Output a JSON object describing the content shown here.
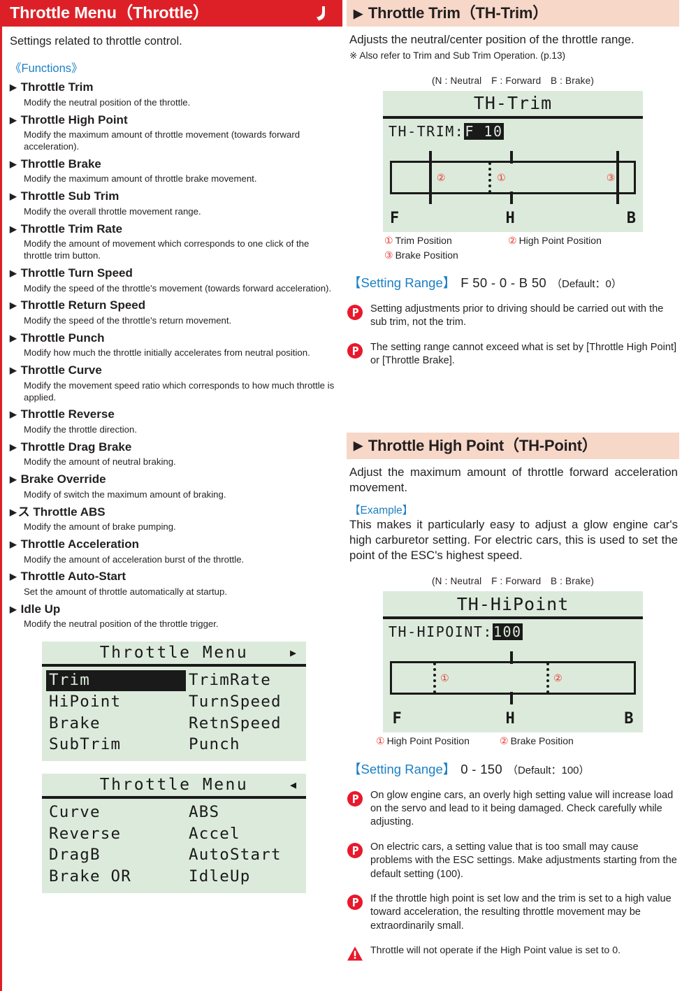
{
  "left": {
    "header_title": "Throttle Menu（Throttle）",
    "header_icon": "throttle-trigger-icon",
    "intro": "Settings related to throttle control.",
    "functions_label": "《Functions》",
    "functions": [
      {
        "name": "Throttle Trim",
        "desc": "Modify the neutral position of the throttle."
      },
      {
        "name": "Throttle High Point",
        "desc": "Modify the maximum amount of throttle movement (towards forward acceleration)."
      },
      {
        "name": "Throttle Brake",
        "desc": "Modify the maximum amount of throttle brake movement."
      },
      {
        "name": "Throttle Sub Trim",
        "desc": "Modify the overall throttle movement range."
      },
      {
        "name": "Throttle Trim Rate",
        "desc": "Modify the amount of movement which corresponds to one click of the throttle trim button."
      },
      {
        "name": "Throttle Turn Speed",
        "desc": "Modify the speed of the throttle's movement (towards forward acceleration)."
      },
      {
        "name": "Throttle Return Speed",
        "desc": "Modify the speed of the throttle's return movement."
      },
      {
        "name": "Throttle Punch",
        "desc": "Modify how much the throttle initially accelerates from neutral position."
      },
      {
        "name": "Throttle Curve",
        "desc": "Modify the movement speed ratio which corresponds to how much throttle is applied."
      },
      {
        "name": "Throttle Reverse",
        "desc": "Modify the throttle direction."
      },
      {
        "name": "Throttle Drag Brake",
        "desc": "Modify the amount of neutral braking."
      },
      {
        "name": "Brake Override",
        "desc": "Modify of switch the maximum amount of braking."
      },
      {
        "name": "ス Throttle ABS",
        "desc": "Modify the amount of brake pumping."
      },
      {
        "name": "Throttle Acceleration",
        "desc": "Modify the amount of acceleration burst of the throttle."
      },
      {
        "name": "Throttle Auto-Start",
        "desc": "Set the amount of throttle automatically at startup."
      },
      {
        "name": "Idle Up",
        "desc": "Modify the neutral position of the throttle trigger."
      }
    ],
    "lcd_menus": [
      {
        "title": "Throttle Menu",
        "arrow": "▶",
        "arrow_name": "lcd-next-page-arrow-icon",
        "items_left": [
          "Trim",
          "HiPoint",
          "Brake",
          "SubTrim"
        ],
        "items_right": [
          "TrimRate",
          "TurnSpeed",
          "RetnSpeed",
          "Punch"
        ],
        "selected": "Trim"
      },
      {
        "title": "Throttle Menu",
        "arrow": "◀",
        "arrow_name": "lcd-prev-page-arrow-icon",
        "items_left": [
          "Curve",
          "Reverse",
          "DragB",
          "Brake OR"
        ],
        "items_right": [
          "ABS",
          "Accel",
          "AutoStart",
          "IdleUp"
        ],
        "selected": ""
      }
    ]
  },
  "right": {
    "trim": {
      "header": "Throttle Trim（TH-Trim）",
      "desc": "Adjusts the neutral/center position of the throttle range.",
      "note": "※ Also refer to Trim and Sub Trim Operation. (p.13)",
      "nfb_legend": "(N : Neutral　F : Forward　B : Brake)",
      "lcd": {
        "title": "TH-Trim",
        "field_label": "TH-TRIM:",
        "field_value": "F 10",
        "axis_f": "F",
        "axis_n": "H",
        "axis_b": "B",
        "marker_1": "①",
        "marker_2": "②",
        "marker_3": "③"
      },
      "legend": [
        {
          "num": "①",
          "text": "Trim Position"
        },
        {
          "num": "②",
          "text": "High Point Position"
        },
        {
          "num": "③",
          "text": "Brake Position"
        }
      ],
      "range_label": "【Setting Range】",
      "range_value": "F 50 - 0 - B 50",
      "range_default": "（Default：0）",
      "notes": [
        "Setting adjustments prior to driving should be carried out with the sub trim, not the trim.",
        "The setting range cannot exceed what is set by [Throttle High Point] or [Throttle Brake]."
      ]
    },
    "hipoint": {
      "header": "Throttle High Point（TH-Point）",
      "desc": "Adjust the maximum amount of throttle forward acceleration movement.",
      "example_label": "【Example】",
      "example_text": "This makes it particularly easy to adjust a glow engine car's high carburetor setting. For electric cars, this is used to set the point of the ESC's highest speed.",
      "nfb_legend": "(N : Neutral　F : Forward　B : Brake)",
      "lcd": {
        "title": "TH-HiPoint",
        "field_label": "TH-HIPOINT:",
        "field_value": "100",
        "axis_f": "F",
        "axis_n": "H",
        "axis_b": "B",
        "marker_1": "①",
        "marker_2": "②"
      },
      "legend": [
        {
          "num": "①",
          "text": "High Point Position"
        },
        {
          "num": "②",
          "text": "Brake Position"
        }
      ],
      "range_label": "【Setting Range】",
      "range_value": "0 - 150",
      "range_default": "（Default：100）",
      "notes": [
        "On glow engine cars, an overly high setting value will increase load on the servo and lead to it being damaged. Check carefully while adjusting.",
        "On electric cars, a setting value that is too small may cause problems with the ESC settings. Make adjustments starting from the default setting (100).",
        "If the throttle high point is set low and the trim is set to a high value toward acceleration, the resulting throttle movement may be extraordinarily small."
      ],
      "warning": "Throttle will not operate if the High Point value is set to 0."
    }
  },
  "colors": {
    "header_red": "#dd2027",
    "header_pink": "#f6d7c8",
    "link_blue": "#1b7fc4",
    "lcd_green": "#dceadb",
    "marker_red": "#e8362e"
  }
}
